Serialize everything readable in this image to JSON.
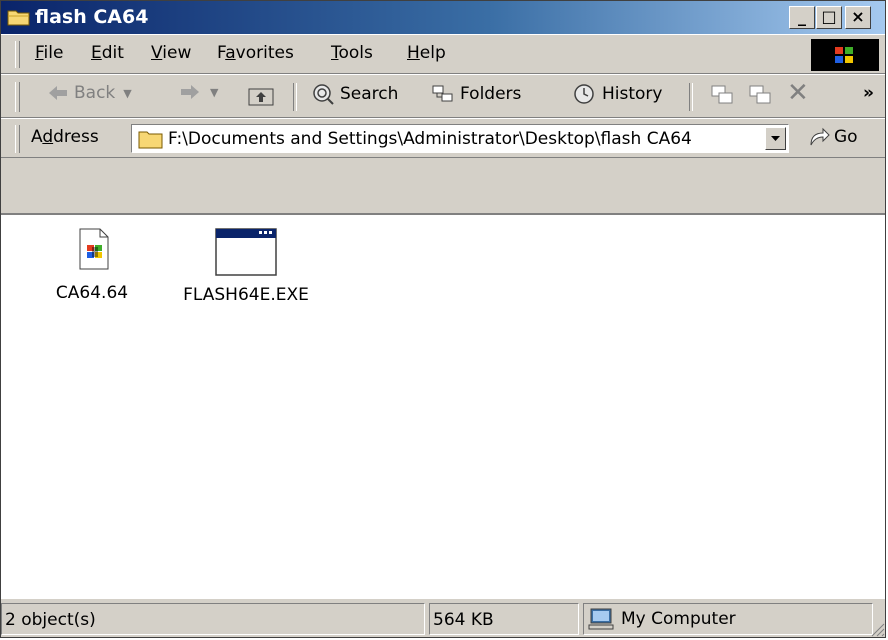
{
  "window": {
    "title": "flash CA64",
    "controls": {
      "minimize": "_",
      "maximize": "□",
      "close": "×"
    }
  },
  "menu": {
    "items": [
      {
        "label": "File",
        "accel": "F"
      },
      {
        "label": "Edit",
        "accel": "E"
      },
      {
        "label": "View",
        "accel": "V"
      },
      {
        "label": "Favorites",
        "accel": "a"
      },
      {
        "label": "Tools",
        "accel": "T"
      },
      {
        "label": "Help",
        "accel": "H"
      }
    ]
  },
  "toolbar": {
    "back": "Back",
    "search": "Search",
    "folders": "Folders",
    "history": "History",
    "more": "»"
  },
  "address": {
    "label": "Address",
    "path": "F:\\Documents and Settings\\Administrator\\Desktop\\flash CA64",
    "go": "Go"
  },
  "files": [
    {
      "name": "CA64.64",
      "icon": "windows-file-icon"
    },
    {
      "name": "FLASH64E.EXE",
      "icon": "application-icon"
    }
  ],
  "status": {
    "objects": "2 object(s)",
    "size": "564 KB",
    "zone": "My Computer"
  },
  "colors": {
    "title_gradient_start": "#0a246a",
    "title_gradient_end": "#a6caf0",
    "face": "#d4d0c8"
  }
}
